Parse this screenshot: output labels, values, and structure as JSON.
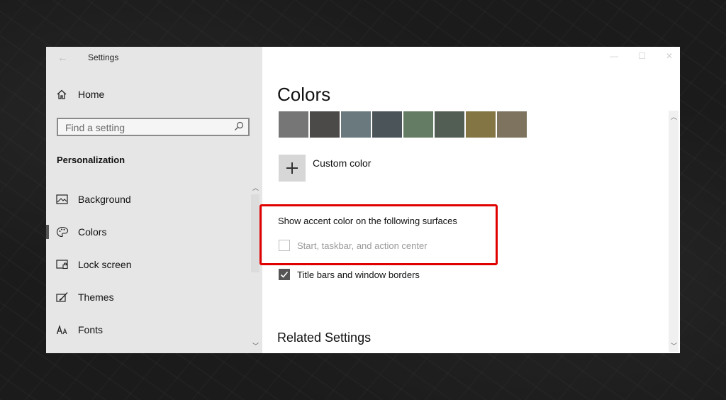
{
  "window": {
    "title": "Settings",
    "back_glyph": "←",
    "controls": {
      "minimize": "—",
      "maximize": "☐",
      "close": "✕"
    }
  },
  "sidebar": {
    "home_label": "Home",
    "search_placeholder": "Find a setting",
    "section_heading": "Personalization",
    "items": [
      {
        "label": "Background",
        "icon": "image-icon",
        "selected": false
      },
      {
        "label": "Colors",
        "icon": "palette-icon",
        "selected": true
      },
      {
        "label": "Lock screen",
        "icon": "lock-screen-icon",
        "selected": false
      },
      {
        "label": "Themes",
        "icon": "brush-icon",
        "selected": false
      },
      {
        "label": "Fonts",
        "icon": "font-icon",
        "selected": false
      }
    ]
  },
  "main": {
    "title": "Colors",
    "swatches": [
      "#767676",
      "#4c4a48",
      "#69797e",
      "#4a5459",
      "#647c64",
      "#525e54",
      "#847545",
      "#7e735f"
    ],
    "custom_color_label": "Custom color",
    "accent_heading": "Show accent color on the following surfaces",
    "checkboxes": [
      {
        "label": "Start, taskbar, and action center",
        "checked": false,
        "disabled": true
      },
      {
        "label": "Title bars and window borders",
        "checked": true,
        "disabled": false
      }
    ],
    "related_heading": "Related Settings"
  },
  "colors": {
    "highlight_border": "#e10000",
    "sidebar_bg": "#e6e6e6",
    "checked_fill": "#555555"
  }
}
